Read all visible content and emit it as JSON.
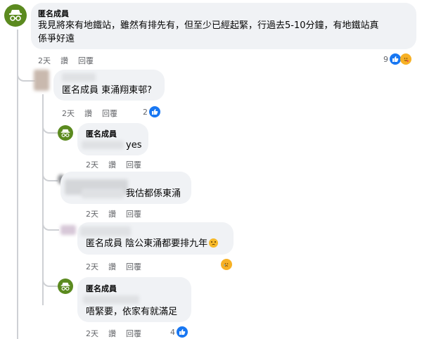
{
  "comments": [
    {
      "author": "匿名成員",
      "text_line1": "我見將來有地鐵站，雖然有排先有，但至少已經起緊，行過去5-10分鐘，有地鐵站真",
      "text_line2": "係爭好遠",
      "time": "2天",
      "like": "讚",
      "reply": "回覆",
      "reaction_count": "9"
    },
    {
      "author": "",
      "text": "匿名成員 東涌翔東邨?",
      "time": "2天",
      "like": "讚",
      "reply": "回覆",
      "reaction_count": "2"
    },
    {
      "author": "匿名成員",
      "text": "yes",
      "time": "2天",
      "like": "讚",
      "reply": "回覆"
    },
    {
      "text": "我估都係東涌",
      "time": "2天",
      "like": "讚",
      "reply": "回覆"
    },
    {
      "text": "匿名成員 陰公東涌都要排九年",
      "time": "2天",
      "like": "讚",
      "reply": "回覆"
    },
    {
      "author": "匿名成員",
      "text": "唔緊要，依家有就滿足",
      "time": "2天",
      "like": "讚",
      "reply": "回覆",
      "reaction_count": "4"
    }
  ],
  "colors": {
    "anon_avatar": "#5b8a1f",
    "like_blue": "#1877f2",
    "bubble": "#f0f2f5"
  }
}
